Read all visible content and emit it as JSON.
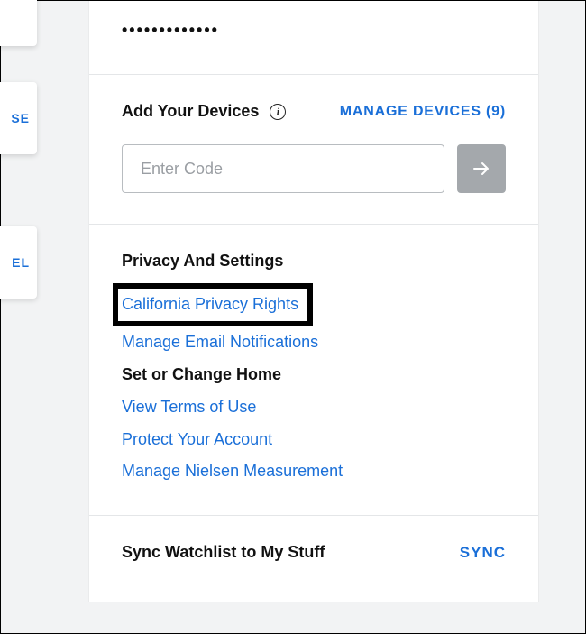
{
  "left_tiles": {
    "t0": "",
    "t1": "SE",
    "t2": "EL"
  },
  "password": {
    "masked": "•••••••••••••"
  },
  "devices": {
    "title": "Add Your Devices",
    "info_glyph": "i",
    "manage_label": "MANAGE DEVICES (9)",
    "input_placeholder": "Enter Code"
  },
  "privacy": {
    "title": "Privacy And Settings",
    "links": {
      "california": "California Privacy Rights",
      "email": "Manage Email Notifications",
      "home": "Set or Change Home",
      "terms": "View Terms of Use",
      "protect": "Protect Your Account",
      "nielsen": "Manage Nielsen Measurement"
    }
  },
  "sync": {
    "label": "Sync Watchlist to My Stuff",
    "button": "SYNC"
  }
}
